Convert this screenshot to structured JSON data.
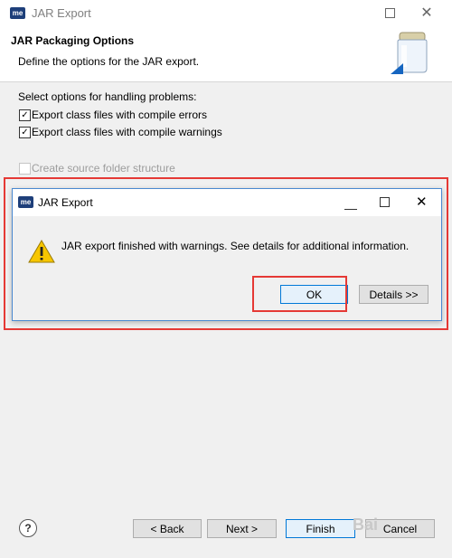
{
  "window": {
    "app_icon": "me",
    "title": "JAR Export",
    "minimize_icon": "minimize-icon",
    "close_icon": "close-icon"
  },
  "header": {
    "title": "JAR Packaging Options",
    "description": "Define the options for the JAR export.",
    "banner_icon": "jar-icon"
  },
  "options": {
    "section_label": "Select options for handling problems:",
    "items": [
      {
        "label": "Export class files with compile errors",
        "checked": true,
        "enabled": true
      },
      {
        "label": "Export class files with compile warnings",
        "checked": true,
        "enabled": true
      },
      {
        "label": "Create source folder structure",
        "checked": false,
        "enabled": false
      }
    ]
  },
  "dialog": {
    "app_icon": "me",
    "title": "JAR Export",
    "icon": "warning-icon",
    "message": "JAR export finished with warnings. See details for additional information.",
    "ok_label": "OK",
    "details_label": "Details >>"
  },
  "buttons": {
    "back_label": "< Back",
    "next_label": "Next >",
    "finish_label": "Finish",
    "cancel_label": "Cancel"
  },
  "watermark": {
    "text": "Bai"
  }
}
